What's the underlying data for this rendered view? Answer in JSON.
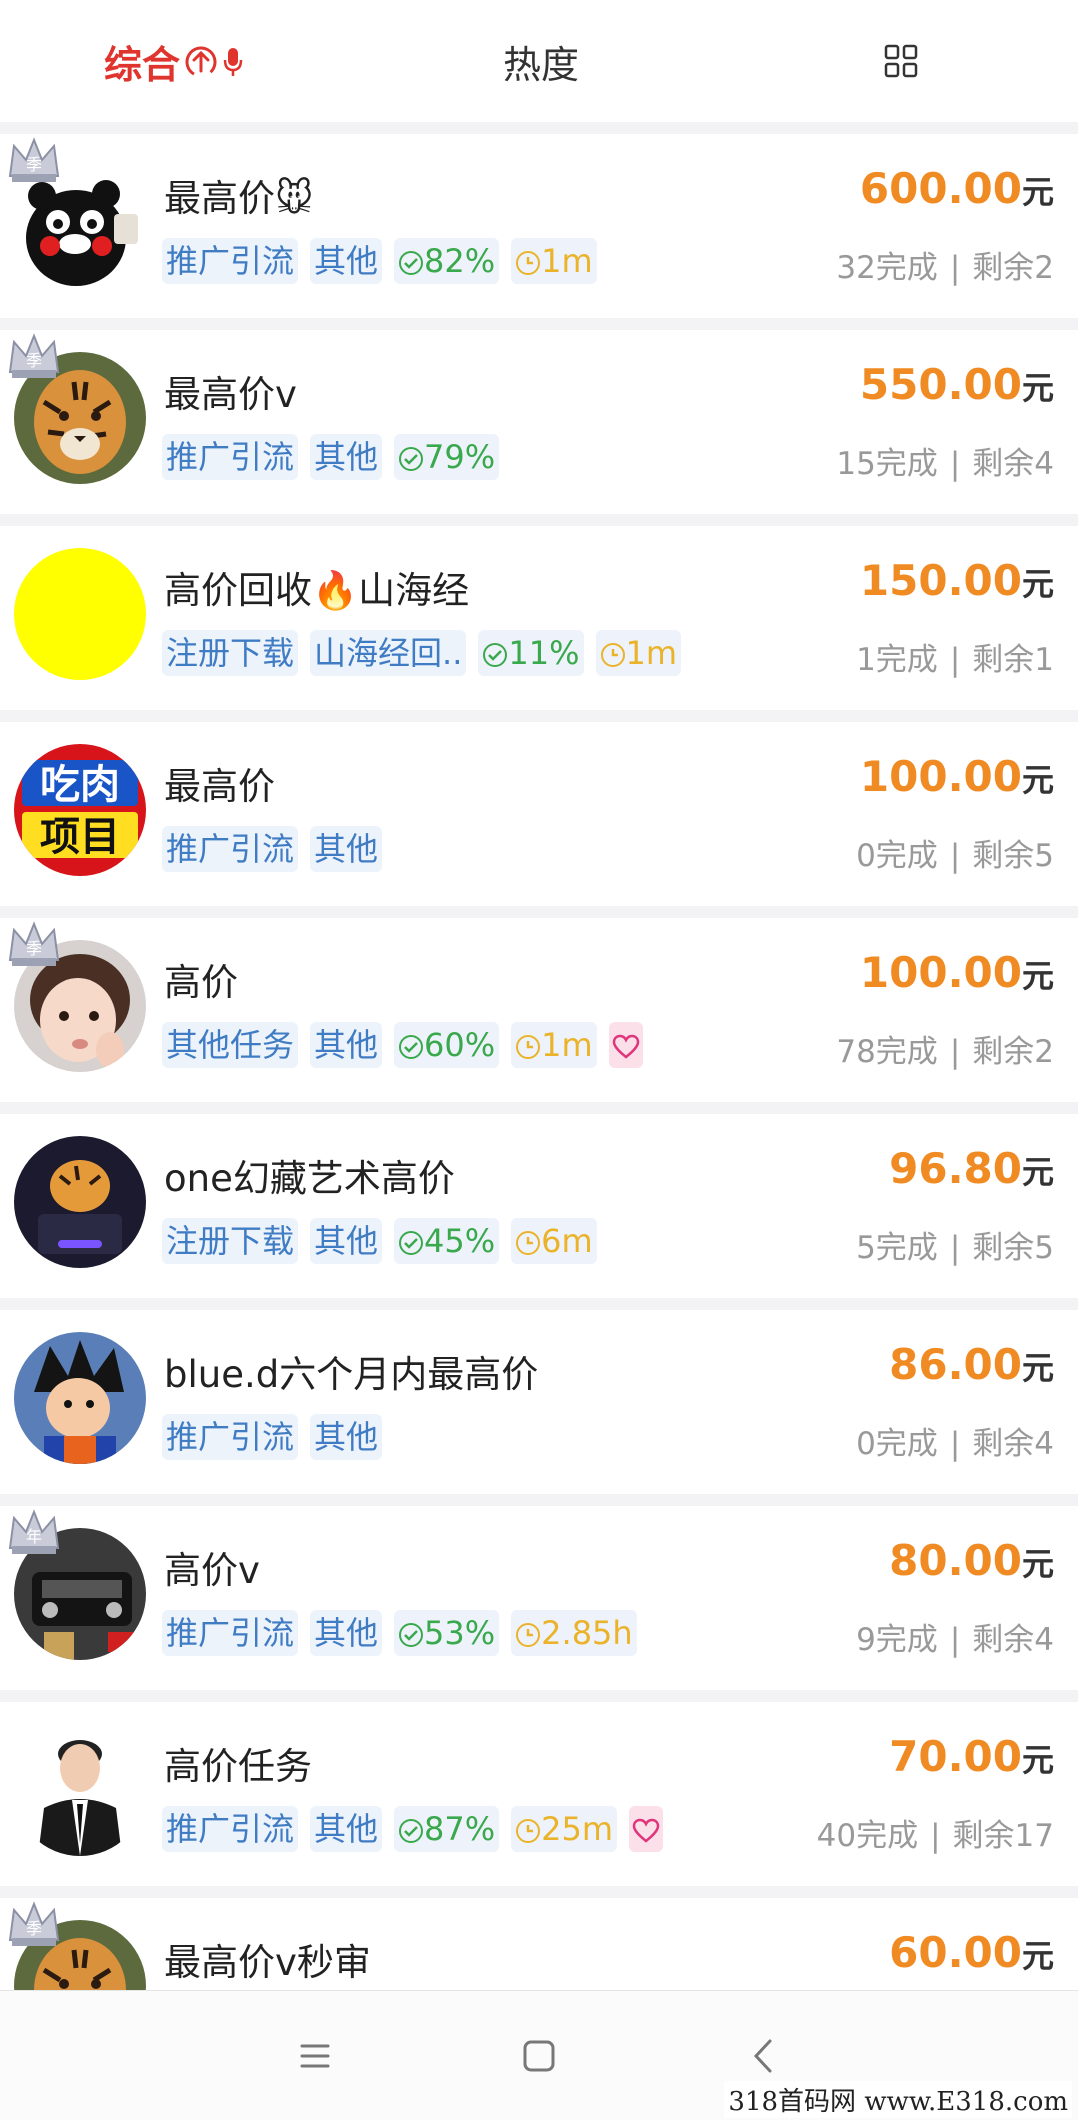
{
  "tabs": {
    "sort_label": "综合",
    "hot_label": "热度"
  },
  "items": [
    {
      "title": "最高价🐭",
      "tags": [
        "推广引流",
        "其他"
      ],
      "rate": "82%",
      "time": "1m",
      "heart": false,
      "price": "600.00",
      "unit": "元",
      "done": "32完成",
      "left": "剩余2",
      "crown": "季",
      "avatar": "bear"
    },
    {
      "title": "最高价v",
      "tags": [
        "推广引流",
        "其他"
      ],
      "rate": "79%",
      "time": "",
      "heart": false,
      "price": "550.00",
      "unit": "元",
      "done": "15完成",
      "left": "剩余4",
      "crown": "季",
      "avatar": "tiger"
    },
    {
      "title": "高价回收🔥山海经",
      "tags": [
        "注册下载",
        "山海经回.."
      ],
      "rate": "11%",
      "time": "1m",
      "heart": false,
      "price": "150.00",
      "unit": "元",
      "done": "1完成",
      "left": "剩余1",
      "crown": "",
      "avatar": "yellow"
    },
    {
      "title": "最高价",
      "tags": [
        "推广引流",
        "其他"
      ],
      "rate": "",
      "time": "",
      "heart": false,
      "price": "100.00",
      "unit": "元",
      "done": "0完成",
      "left": "剩余5",
      "crown": "",
      "avatar": "meat"
    },
    {
      "title": "高价",
      "tags": [
        "其他任务",
        "其他"
      ],
      "rate": "60%",
      "time": "1m",
      "heart": true,
      "price": "100.00",
      "unit": "元",
      "done": "78完成",
      "left": "剩余2",
      "crown": "季",
      "avatar": "child"
    },
    {
      "title": "one幻藏艺术高价",
      "tags": [
        "注册下载",
        "其他"
      ],
      "rate": "45%",
      "time": "6m",
      "heart": false,
      "price": "96.80",
      "unit": "元",
      "done": "5完成",
      "left": "剩余5",
      "crown": "",
      "avatar": "art"
    },
    {
      "title": "blue.d六个月内最高价",
      "tags": [
        "推广引流",
        "其他"
      ],
      "rate": "",
      "time": "",
      "heart": false,
      "price": "86.00",
      "unit": "元",
      "done": "0完成",
      "left": "剩余4",
      "crown": "",
      "avatar": "goku"
    },
    {
      "title": "高价v",
      "tags": [
        "推广引流",
        "其他"
      ],
      "rate": "53%",
      "time": "2.85h",
      "heart": false,
      "price": "80.00",
      "unit": "元",
      "done": "9完成",
      "left": "剩余4",
      "crown": "年",
      "avatar": "car"
    },
    {
      "title": "高价任务",
      "tags": [
        "推广引流",
        "其他"
      ],
      "rate": "87%",
      "time": "25m",
      "heart": true,
      "price": "70.00",
      "unit": "元",
      "done": "40完成",
      "left": "剩余17",
      "crown": "",
      "avatar": "suit"
    },
    {
      "title": "最高价v秒审",
      "tags": [],
      "rate": "",
      "time": "",
      "heart": false,
      "price": "60.00",
      "unit": "元",
      "done": "",
      "left": "",
      "crown": "季",
      "avatar": "tiger"
    }
  ],
  "watermark": "318首码网 www.E318.com"
}
